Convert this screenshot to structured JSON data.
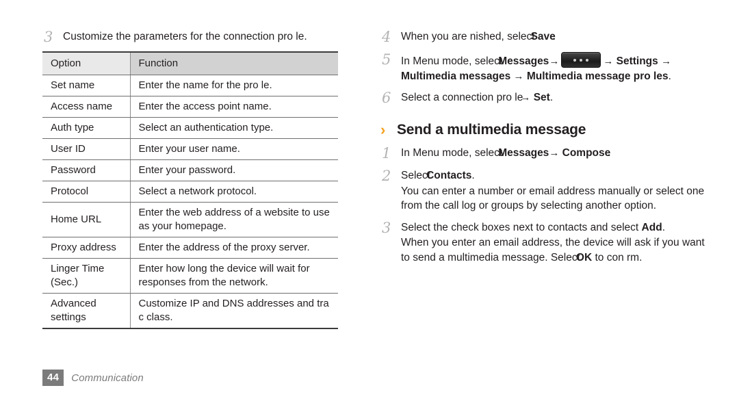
{
  "page": {
    "footer_page_number": "44",
    "footer_section": "Communication",
    "accent_color": "#f5a11e",
    "page_num_bg": "#7b7b7b"
  },
  "left_column": {
    "step3": {
      "number": "3",
      "text": "Customize the parameters for the connection pro le."
    },
    "table": {
      "headers": [
        "Option",
        "Function"
      ],
      "rows": [
        {
          "option": "Set name",
          "function": "Enter the name for the pro le."
        },
        {
          "option": "Access name",
          "function": "Enter the access point name."
        },
        {
          "option": "Auth type",
          "function": "Select an authentication type."
        },
        {
          "option": "User ID",
          "function": "Enter your user name."
        },
        {
          "option": "Password",
          "function": "Enter your password."
        },
        {
          "option": "Protocol",
          "function": "Select a network protocol."
        },
        {
          "option": "Home URL",
          "function": "Enter the web address of a website to use as your homepage."
        },
        {
          "option": "Proxy address",
          "function": "Enter the address of the proxy server."
        },
        {
          "option": "Linger Time (Sec.)",
          "function": "Enter how long the device will wait for responses from the network."
        },
        {
          "option": "Advanced settings",
          "function": "Customize IP and DNS addresses and tra c class."
        }
      ]
    }
  },
  "right_column": {
    "step4": {
      "number": "4",
      "text_before": "When you are  nished, select",
      "bold": "Save",
      "text_after": "."
    },
    "step5": {
      "number": "5",
      "t1": "In Menu mode, select",
      "b1": "Messages",
      "a1": "→",
      "icon": "more-options-key-icon",
      "a2": "→",
      "b2": "Settings",
      "a3": "→",
      "b3": "Multimedia messages",
      "a4": "→",
      "b4": "Multimedia message pro les",
      "t_end": "."
    },
    "step6": {
      "number": "6",
      "t1": "Select a connection pro le",
      "a1": "→",
      "b1": "Set",
      "t_end": "."
    },
    "heading": {
      "chevron": "›",
      "title": "Send a multimedia message"
    },
    "step1": {
      "number": "1",
      "t1": "In Menu mode, select",
      "b1": "Messages",
      "a1": "→",
      "b2": "Compose",
      "t_end": "."
    },
    "step2": {
      "number": "2",
      "t1": "Select",
      "b1": "Contacts",
      "t_end": ".",
      "note": "You can enter a number or email address manually or select one from the call log or groups by selecting another option."
    },
    "step3": {
      "number": "3",
      "t1": "Select the check boxes next to contacts and select",
      "b1": "Add",
      "t_end": ".",
      "note_before": "When you enter an email address, the device will ask if you want to send a multimedia message. Select",
      "note_bold": "OK",
      "note_after": "to con rm."
    }
  }
}
